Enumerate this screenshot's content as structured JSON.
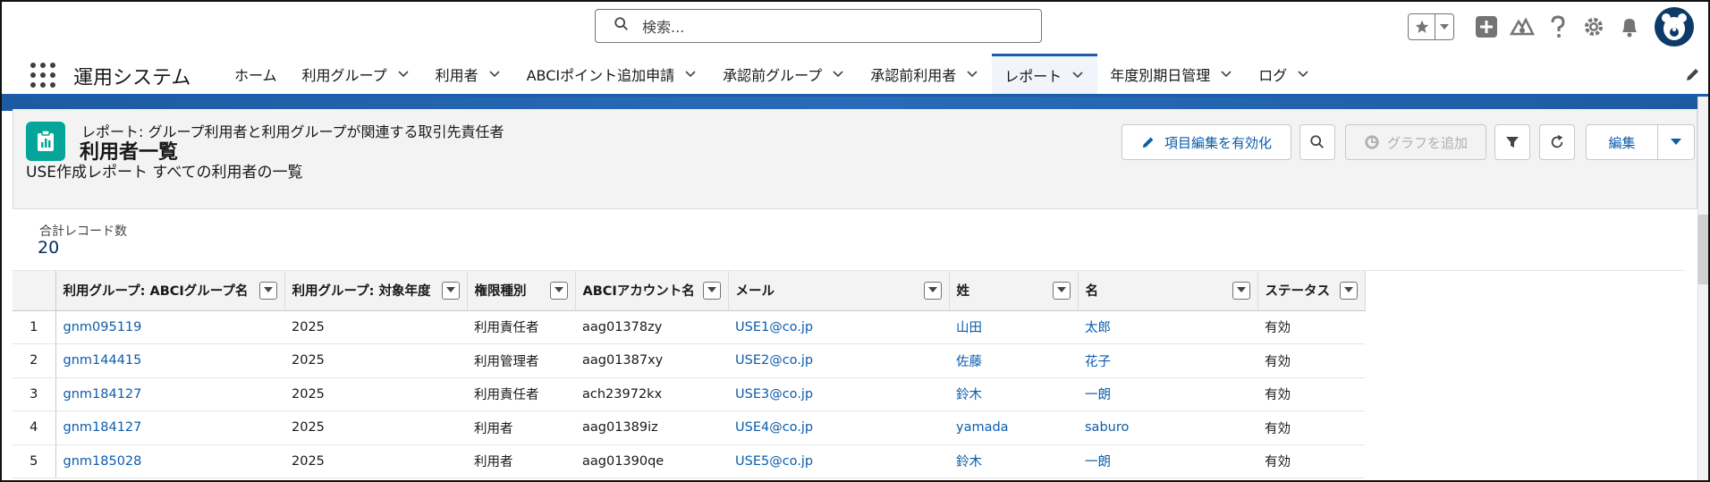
{
  "header": {
    "search_placeholder": "検索...",
    "icons": [
      "search-icon",
      "star-icon",
      "chevron-down-icon",
      "plus-icon",
      "trailhead-icon",
      "help-icon",
      "gear-icon",
      "bell-icon",
      "avatar"
    ]
  },
  "nav": {
    "app_name": "運用システム",
    "items": [
      {
        "label": "ホーム",
        "has_menu": false
      },
      {
        "label": "利用グループ",
        "has_menu": true
      },
      {
        "label": "利用者",
        "has_menu": true
      },
      {
        "label": "ABCIポイント追加申請",
        "has_menu": true
      },
      {
        "label": "承認前グループ",
        "has_menu": true
      },
      {
        "label": "承認前利用者",
        "has_menu": true
      },
      {
        "label": "レポート",
        "has_menu": true,
        "active": true
      },
      {
        "label": "年度別期日管理",
        "has_menu": true
      },
      {
        "label": "ログ",
        "has_menu": true
      }
    ]
  },
  "report": {
    "subtitle": "レポート: グループ利用者と利用グループが関連する取引先責任者",
    "title": "利用者一覧",
    "description": "USE作成レポート すべての利用者の一覧",
    "buttons": {
      "enable_edit": "項目編集を有効化",
      "add_chart": "グラフを追加",
      "edit": "編集"
    },
    "record_count_label": "合計レコード数",
    "record_count": "20"
  },
  "table": {
    "columns": [
      "利用グループ: ABCIグループ名",
      "利用グループ: 対象年度",
      "権限種別",
      "ABCIアカウント名",
      "メール",
      "姓",
      "名",
      "ステータス"
    ],
    "rows": [
      {
        "num": "1",
        "group": "gnm095119",
        "year": "2025",
        "role": "利用責任者",
        "account": "aag01378zy",
        "email": "USE1@co.jp",
        "last": "山田",
        "first": "太郎",
        "status": "有効"
      },
      {
        "num": "2",
        "group": "gnm144415",
        "year": "2025",
        "role": "利用管理者",
        "account": "aag01387xy",
        "email": "USE2@co.jp",
        "last": "佐藤",
        "first": "花子",
        "status": "有効"
      },
      {
        "num": "3",
        "group": "gnm184127",
        "year": "2025",
        "role": "利用責任者",
        "account": "ach23972kx",
        "email": "USE3@co.jp",
        "last": "鈴木",
        "first": "一朗",
        "status": "有効"
      },
      {
        "num": "4",
        "group": "gnm184127",
        "year": "2025",
        "role": "利用者",
        "account": "aag01389iz",
        "email": "USE4@co.jp",
        "last": "yamada",
        "first": "saburo",
        "status": "有効"
      },
      {
        "num": "5",
        "group": "gnm185028",
        "year": "2025",
        "role": "利用者",
        "account": "aag01390qe",
        "email": "USE5@co.jp",
        "last": "鈴木",
        "first": "一朗",
        "status": "有効"
      }
    ]
  },
  "colors": {
    "brand": "#1b5da8",
    "link": "#0b5cab",
    "report_icon": "#06a59a"
  }
}
